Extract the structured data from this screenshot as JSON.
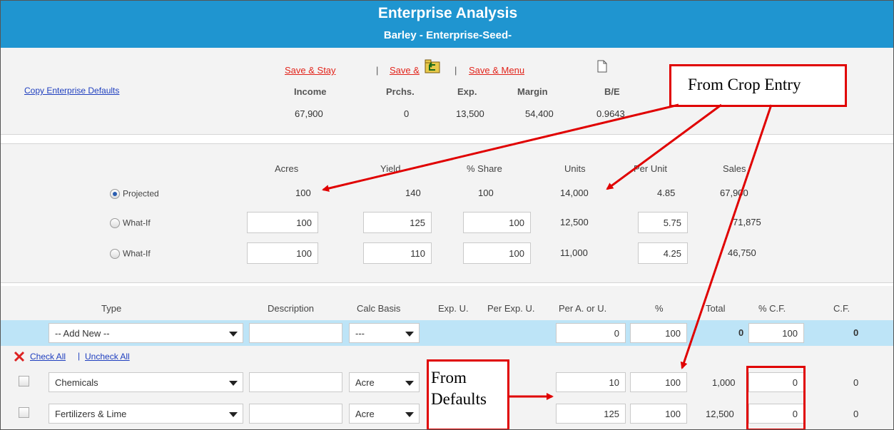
{
  "header": {
    "title": "Enterprise Analysis",
    "subtitle": "Barley - Enterprise-Seed-"
  },
  "actions": {
    "save_stay": "Save & Stay",
    "sep": "|",
    "save_back": "Save &",
    "save_menu": "Save & Menu",
    "copy_defaults": "Copy Enterprise Defaults"
  },
  "summary": {
    "headers": [
      "Income",
      "Prchs.",
      "Exp.",
      "Margin",
      "B/E"
    ],
    "values": [
      "67,900",
      "0",
      "13,500",
      "54,400",
      "0.9643"
    ]
  },
  "scenarios": {
    "headers": [
      "Acres",
      "Yield",
      "% Share",
      "Units",
      "Per Unit",
      "Sales"
    ],
    "rows": [
      {
        "label": "Projected",
        "selected": true,
        "acres": "100",
        "yield": "140",
        "share": "100",
        "units": "14,000",
        "per_unit": "4.85",
        "sales": "67,900"
      },
      {
        "label": "What-If",
        "selected": false,
        "acres": "100",
        "yield": "125",
        "share": "100",
        "units": "12,500",
        "per_unit": "5.75",
        "sales": "71,875"
      },
      {
        "label": "What-If",
        "selected": false,
        "acres": "100",
        "yield": "110",
        "share": "100",
        "units": "11,000",
        "per_unit": "4.25",
        "sales": "46,750"
      }
    ]
  },
  "detail": {
    "headers": [
      "Type",
      "Description",
      "Calc Basis",
      "Exp. U.",
      "Per Exp. U.",
      "Per A. or U.",
      "%",
      "Total",
      "% C.F.",
      "C.F."
    ],
    "add_row": {
      "type": "-- Add New --",
      "description": "",
      "calc_basis": "---",
      "per_a": "0",
      "pct": "100",
      "total": "0",
      "pct_cf": "100",
      "cf": "0"
    },
    "check_all": "Check All",
    "sep": "|",
    "uncheck_all": "Uncheck All",
    "rows": [
      {
        "type": "Chemicals",
        "description": "",
        "calc_basis": "Acre",
        "per_a": "10",
        "pct": "100",
        "total": "1,000",
        "pct_cf": "0",
        "cf": "0"
      },
      {
        "type": "Fertilizers & Lime",
        "description": "",
        "calc_basis": "Acre",
        "per_a": "125",
        "pct": "100",
        "total": "12,500",
        "pct_cf": "0",
        "cf": "0"
      }
    ]
  },
  "annotations": {
    "crop_entry": "From Crop Entry",
    "defaults_line1": "From",
    "defaults_line2": "Defaults",
    "color": "#e00000"
  },
  "colors": {
    "header_bg": "#1f95d0",
    "add_row_bg": "#bde4f7",
    "link": "#1f3fbf",
    "save_link": "#e2231a"
  }
}
